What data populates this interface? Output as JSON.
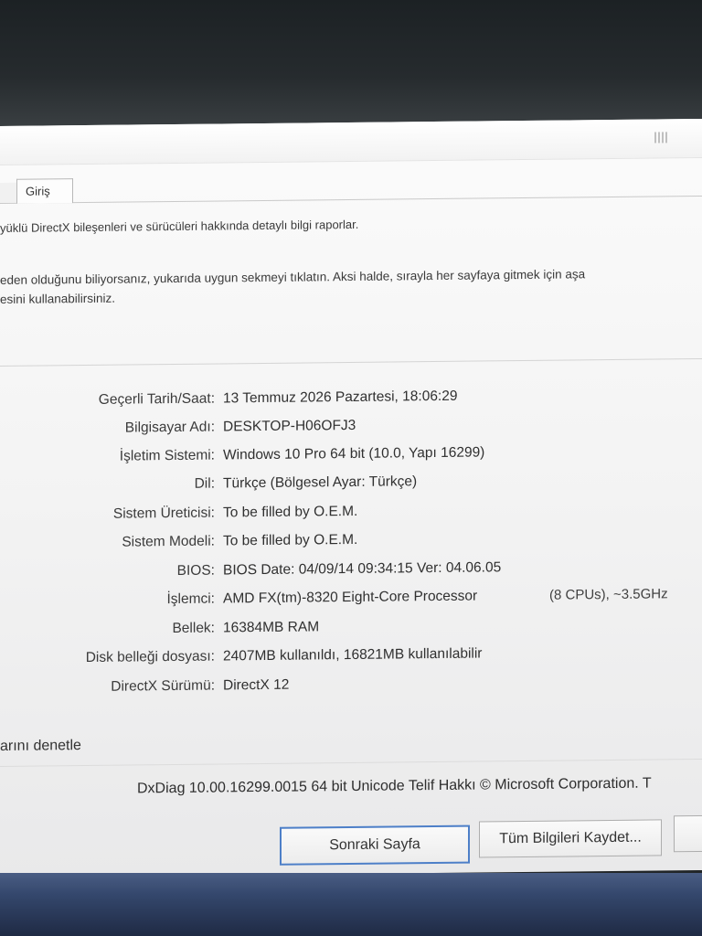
{
  "tabs": [
    {
      "label": "Giriş"
    }
  ],
  "intro": {
    "line1": "yüklü DirectX bileşenleri ve sürücüleri hakkında detaylı bilgi raporlar.",
    "line2": "eden olduğunu biliyorsanız, yukarıda uygun sekmeyi tıklatın. Aksi halde, sırayla her sayfaya gitmek için aşa",
    "line3": "esini kullanabilirsiniz."
  },
  "system_info": [
    {
      "label": "Geçerli Tarih/Saat:",
      "value": "13 Temmuz 2026 Pazartesi, 18:06:29"
    },
    {
      "label": "Bilgisayar Adı:",
      "value": "DESKTOP-H06OFJ3"
    },
    {
      "label": "İşletim Sistemi:",
      "value": "Windows 10 Pro 64 bit (10.0, Yapı 16299)"
    },
    {
      "label": "Dil:",
      "value": "Türkçe (Bölgesel Ayar: Türkçe)"
    },
    {
      "label": "Sistem Üreticisi:",
      "value": "To be filled by O.E.M."
    },
    {
      "label": "Sistem Modeli:",
      "value": "To be filled by O.E.M."
    },
    {
      "label": "BIOS:",
      "value": "BIOS Date: 04/09/14 09:34:15 Ver: 04.06.05"
    },
    {
      "label": "İşlemci:",
      "value": "AMD FX(tm)-8320 Eight-Core Processor",
      "extra": "(8 CPUs), ~3.5GHz"
    },
    {
      "label": "Bellek:",
      "value": "16384MB RAM"
    },
    {
      "label": "Disk belleği dosyası:",
      "value": "2407MB kullanıldı, 16821MB kullanılabilir"
    },
    {
      "label": "DirectX Sürümü:",
      "value": "DirectX 12"
    }
  ],
  "check_text": "arını denetle",
  "footer": "DxDiag 10.00.16299.0015 64 bit Unicode  Telif Hakkı © Microsoft Corporation. T",
  "buttons": {
    "next": "Sonraki Sayfa",
    "save_all": "Tüm Bilgileri Kaydet..."
  }
}
